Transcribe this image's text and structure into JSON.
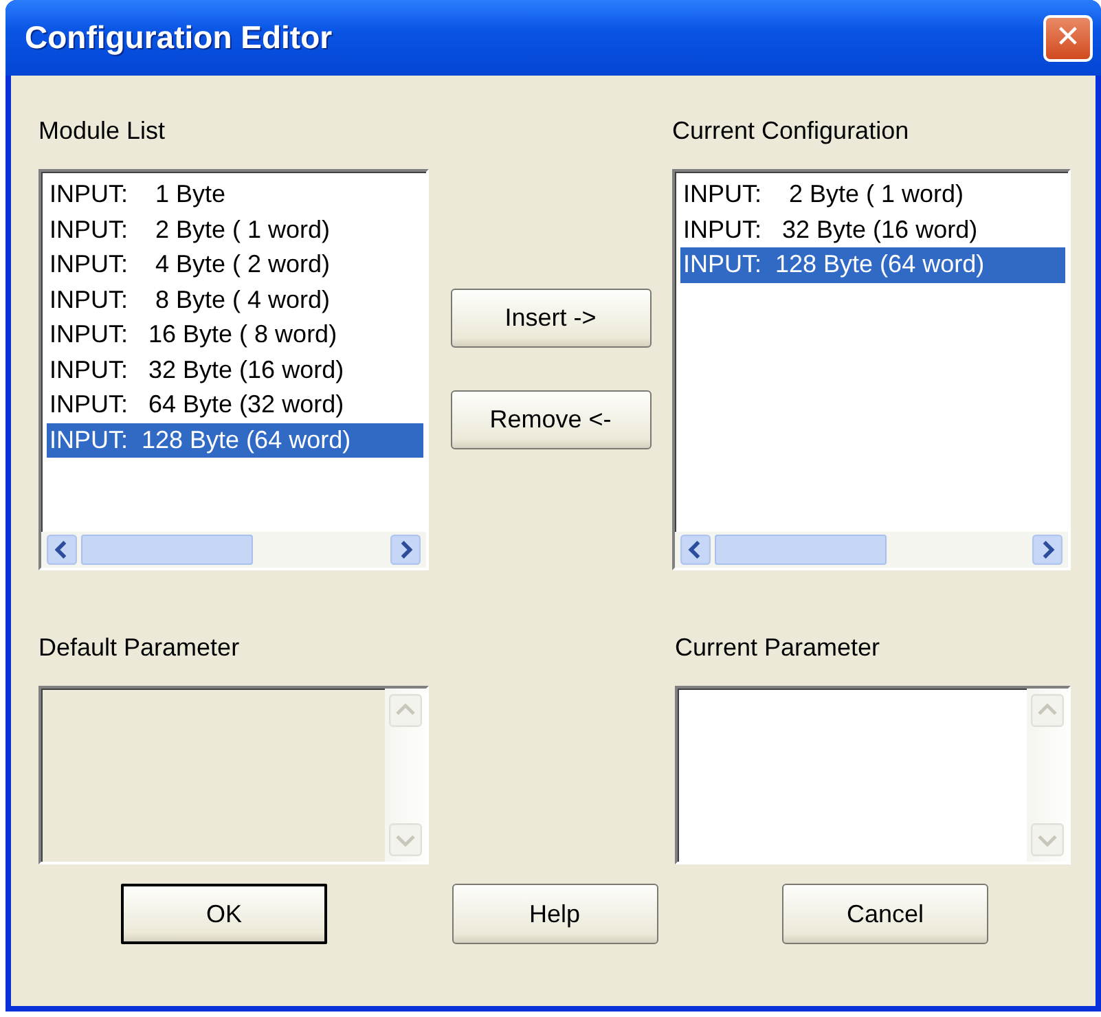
{
  "window": {
    "title": "Configuration Editor",
    "close": "✕"
  },
  "module_list": {
    "label": "Module List",
    "items": [
      {
        "text": "INPUT:    1 Byte",
        "selected": false
      },
      {
        "text": "INPUT:    2 Byte ( 1 word)",
        "selected": false
      },
      {
        "text": "INPUT:    4 Byte ( 2 word)",
        "selected": false
      },
      {
        "text": "INPUT:    8 Byte ( 4 word)",
        "selected": false
      },
      {
        "text": "INPUT:   16 Byte ( 8 word)",
        "selected": false
      },
      {
        "text": "INPUT:   32 Byte (16 word)",
        "selected": false
      },
      {
        "text": "INPUT:   64 Byte (32 word)",
        "selected": false
      },
      {
        "text": "INPUT:  128 Byte (64 word)",
        "selected": true
      }
    ]
  },
  "middle_buttons": [
    {
      "label": "Insert ->"
    },
    {
      "label": "Remove <-"
    }
  ],
  "current_configuration": {
    "label": "Current Configuration",
    "items": [
      {
        "text": "INPUT:    2 Byte ( 1 word)",
        "selected": false
      },
      {
        "text": "INPUT:   32 Byte (16 word)",
        "selected": false
      },
      {
        "text": "INPUT:  128 Byte (64 word)",
        "selected": true
      }
    ]
  },
  "default_parameter": {
    "label": "Default Parameter",
    "disabled": true
  },
  "current_parameter": {
    "label": "Current Parameter",
    "disabled": false
  },
  "buttons": [
    {
      "label": "OK",
      "default": true
    },
    {
      "label": "Help",
      "default": false
    },
    {
      "label": "Cancel",
      "default": false
    }
  ]
}
